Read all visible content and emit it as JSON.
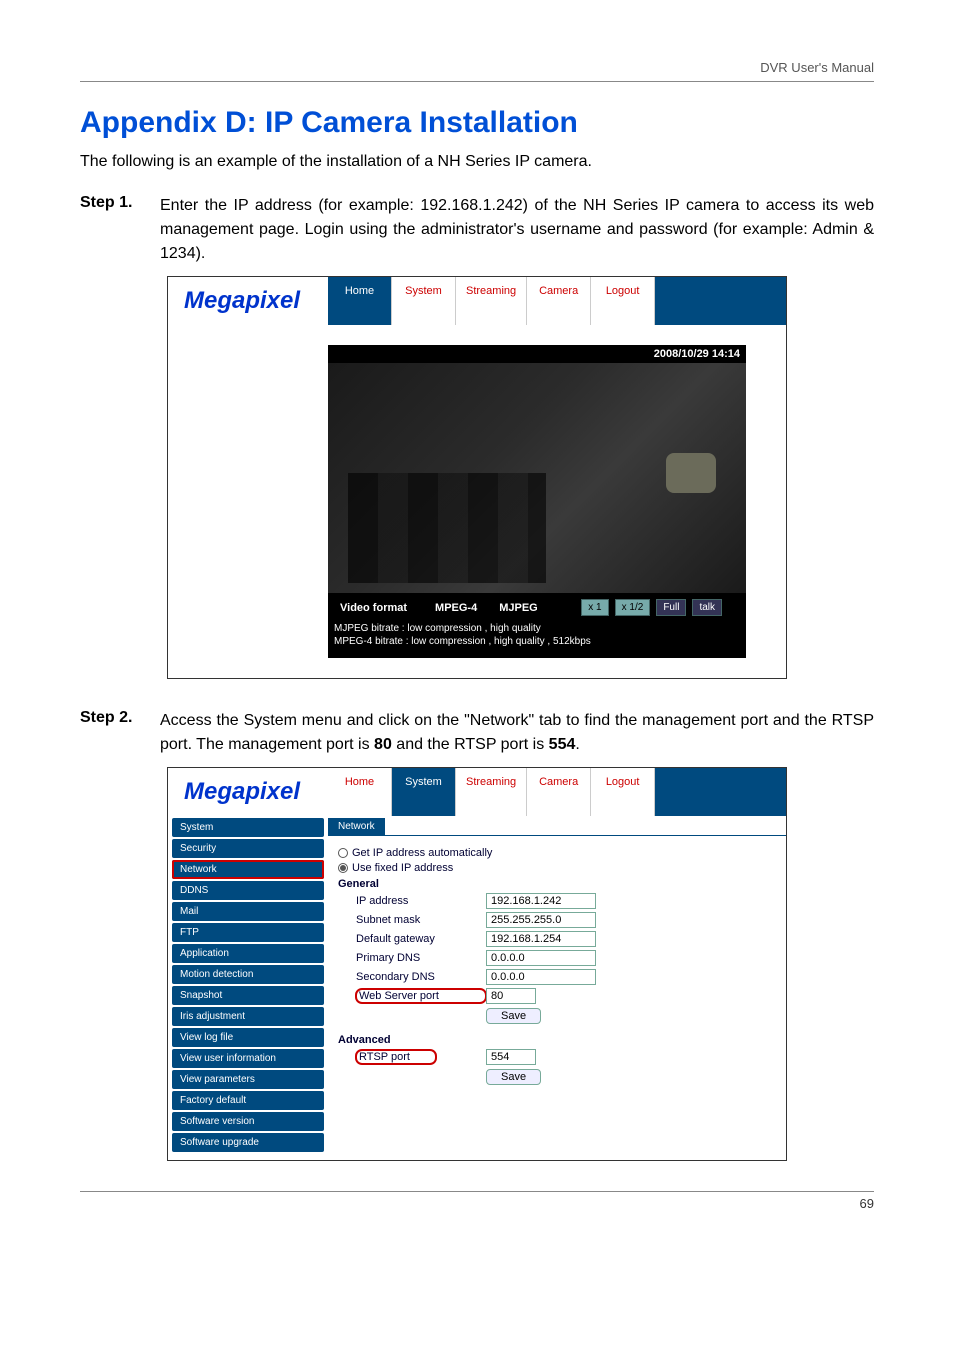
{
  "doc": {
    "header_right": "DVR User's Manual",
    "title": "Appendix D: IP Camera Installation",
    "intro": "The following is an example of the installation of a NH Series IP camera.",
    "step1_label": "Step 1.",
    "step1_text": "Enter the IP address (for example: 192.168.1.242) of the NH Series IP camera to access its web management page. Login using the administrator's username and password (for example: Admin & 1234).",
    "step2_label": "Step 2.",
    "step2_text_a": "Access the System menu and click on the \"Network\" tab to find the management port and the RTSP port. The management port is ",
    "step2_text_b": " and the RTSP port is ",
    "step2_text_c": ".",
    "mgmt_port_bold": "80",
    "rtsp_port_bold": "554",
    "page_number": "69"
  },
  "shot1": {
    "brand": "Megapixel",
    "tabs": [
      "Home",
      "System",
      "Streaming",
      "Camera",
      "Logout"
    ],
    "active_tab_index": 0,
    "timestamp": "2008/10/29 14:14",
    "video_format_label": "Video format",
    "codec_mpeg4": "MPEG-4",
    "codec_mjpeg": "MJPEG",
    "ctrl_x1": "x 1",
    "ctrl_x12": "x 1/2",
    "ctrl_full": "Full",
    "ctrl_talk": "talk",
    "bitrate_line1": "MJPEG bitrate : low compression , high quality",
    "bitrate_line2": "MPEG-4 bitrate : low compression , high quality , 512kbps"
  },
  "shot2": {
    "brand": "Megapixel",
    "tabs": [
      "Home",
      "System",
      "Streaming",
      "Camera",
      "Logout"
    ],
    "active_tab_index": 1,
    "sidebar": [
      "System",
      "Security",
      "Network",
      "DDNS",
      "Mail",
      "FTP",
      "Application",
      "Motion detection",
      "Snapshot",
      "Iris adjustment",
      "View log file",
      "View user information",
      "View parameters",
      "Factory default",
      "Software version",
      "Software upgrade"
    ],
    "sidebar_selected_index": 2,
    "section_title": "Network",
    "radio_auto": "Get IP address automatically",
    "radio_fixed": "Use fixed IP address",
    "general_label": "General",
    "fields": {
      "ip_label": "IP address",
      "ip_value": "192.168.1.242",
      "mask_label": "Subnet mask",
      "mask_value": "255.255.255.0",
      "gw_label": "Default gateway",
      "gw_value": "192.168.1.254",
      "pdns_label": "Primary DNS",
      "pdns_value": "0.0.0.0",
      "sdns_label": "Secondary DNS",
      "sdns_value": "0.0.0.0",
      "web_label": "Web Server port",
      "web_value": "80"
    },
    "save_label": "Save",
    "advanced_label": "Advanced",
    "rtsp_label": "RTSP port",
    "rtsp_value": "554"
  }
}
